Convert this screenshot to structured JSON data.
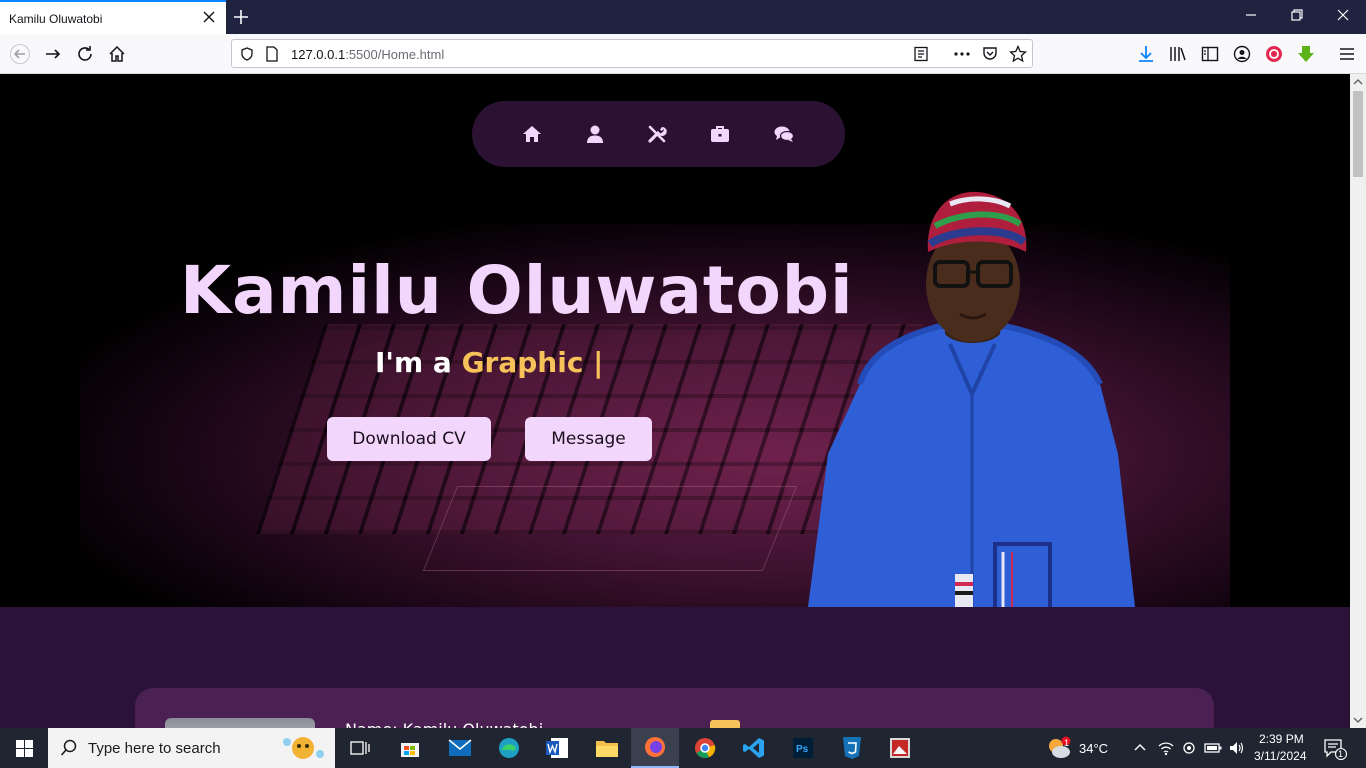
{
  "browser": {
    "tab_title": "Kamilu Oluwatobi",
    "url_host": "127.0.0.1",
    "url_rest": ":5500/Home.html"
  },
  "nav": {
    "items": [
      "home-icon",
      "user-icon",
      "tools-icon",
      "briefcase-icon",
      "comments-icon"
    ]
  },
  "hero": {
    "name": "Kamilu Oluwatobi",
    "role_prefix": "I'm a",
    "role_word": "Graphic |",
    "download_label": "Download CV",
    "message_label": "Message"
  },
  "about": {
    "name_line": "Name: Kamilu Oluwatobi"
  },
  "taskbar": {
    "search_placeholder": "Type here to search",
    "weather": "34°C",
    "time": "2:39 PM",
    "date": "3/11/2024",
    "notification_count": "1"
  },
  "colors": {
    "accent_pink": "#f3d6fb",
    "accent_gold": "#f7c25a",
    "nav_pill": "#2b1232",
    "section_bg": "#2a1238"
  }
}
